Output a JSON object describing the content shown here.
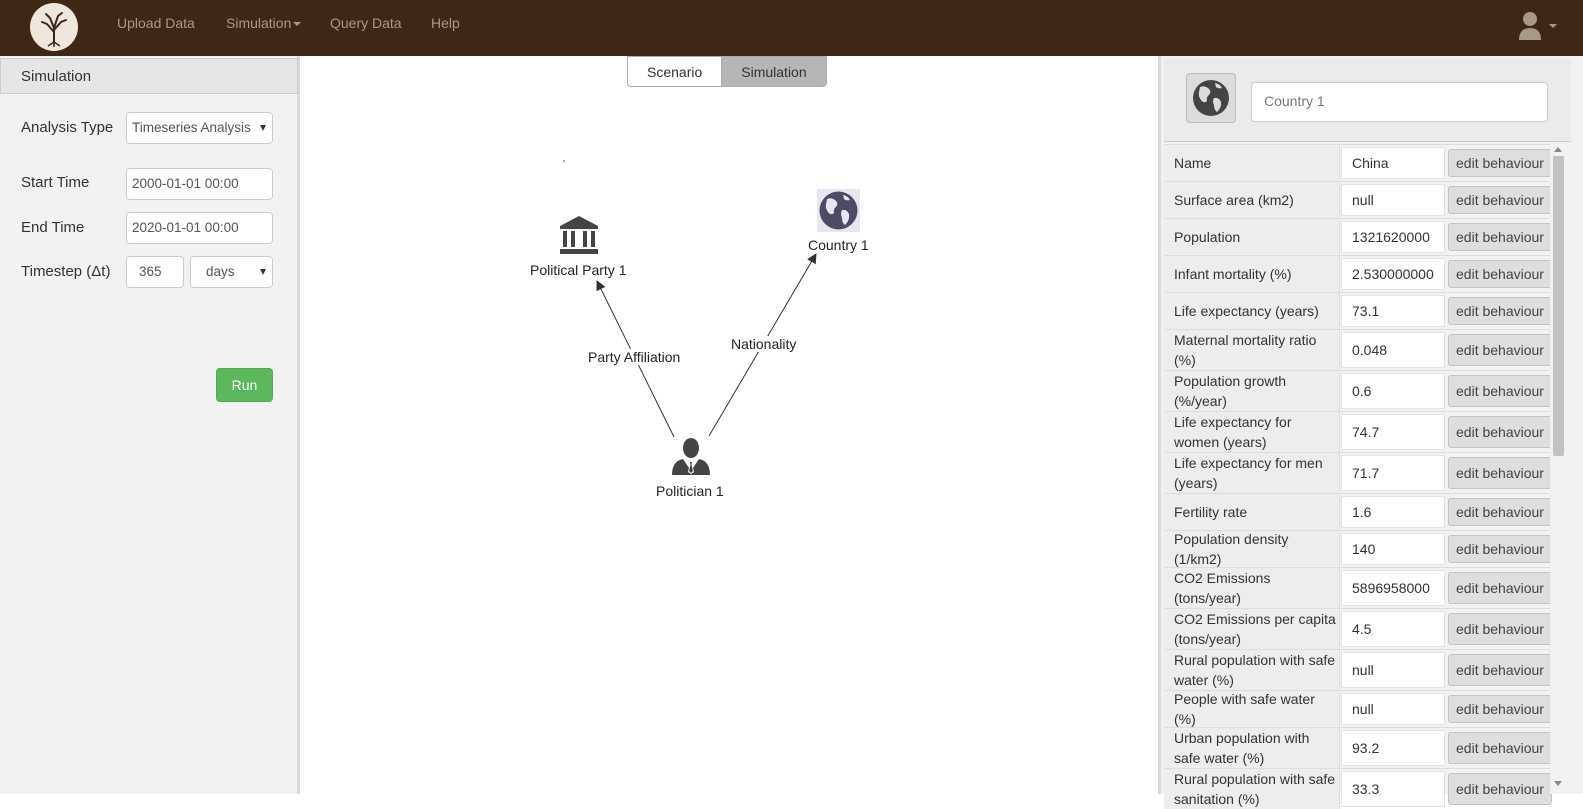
{
  "nav": {
    "links": [
      "Upload Data",
      "Simulation",
      "Query Data",
      "Help"
    ]
  },
  "simulation_panel": {
    "title": "Simulation",
    "analysis_type_label": "Analysis Type",
    "analysis_type_value": "Timeseries Analysis",
    "start_time_label": "Start Time",
    "start_time_value": "2000-01-01 00:00",
    "end_time_label": "End Time",
    "end_time_value": "2020-01-01 00:00",
    "timestep_label": "Timestep (Δt)",
    "timestep_value": "365",
    "timestep_unit": "days",
    "run_label": "Run"
  },
  "tabs": [
    "Scenario",
    "Simulation"
  ],
  "graph": {
    "nodes": {
      "party": "Political Party 1",
      "country": "Country 1",
      "politician": "Politician 1"
    },
    "edges": {
      "affiliation": "Party Affiliation",
      "nationality": "Nationality"
    }
  },
  "entity": {
    "name": "Country 1",
    "edit_label": "edit behaviour",
    "properties": [
      {
        "name": "Name",
        "value": "China"
      },
      {
        "name": "Surface area (km2)",
        "value": "null"
      },
      {
        "name": "Population",
        "value": "1321620000"
      },
      {
        "name": "Infant mortality (%)",
        "value": "2.530000000"
      },
      {
        "name": "Life expectancy (years)",
        "value": "73.1"
      },
      {
        "name": "Maternal mortality ratio (%)",
        "value": "0.048"
      },
      {
        "name": "Population growth (%/year)",
        "value": "0.6"
      },
      {
        "name": "Life expectancy for women (years)",
        "value": "74.7"
      },
      {
        "name": "Life expectancy for men (years)",
        "value": "71.7"
      },
      {
        "name": "Fertility rate",
        "value": "1.6"
      },
      {
        "name": "Population density (1/km2)",
        "value": "140"
      },
      {
        "name": "CO2 Emissions (tons/year)",
        "value": "5896958000"
      },
      {
        "name": "CO2 Emissions per capita (tons/year)",
        "value": "4.5"
      },
      {
        "name": "Rural population with safe water (%)",
        "value": "null"
      },
      {
        "name": "People with safe water (%)",
        "value": "null"
      },
      {
        "name": "Urban population with safe water (%)",
        "value": "93.2"
      },
      {
        "name": "Rural population with safe sanitation (%)",
        "value": "33.3"
      }
    ]
  },
  "colors": {
    "navbar": "#3e2815",
    "run_button": "#5cb85c",
    "globe_icon": "#4b4b66"
  }
}
